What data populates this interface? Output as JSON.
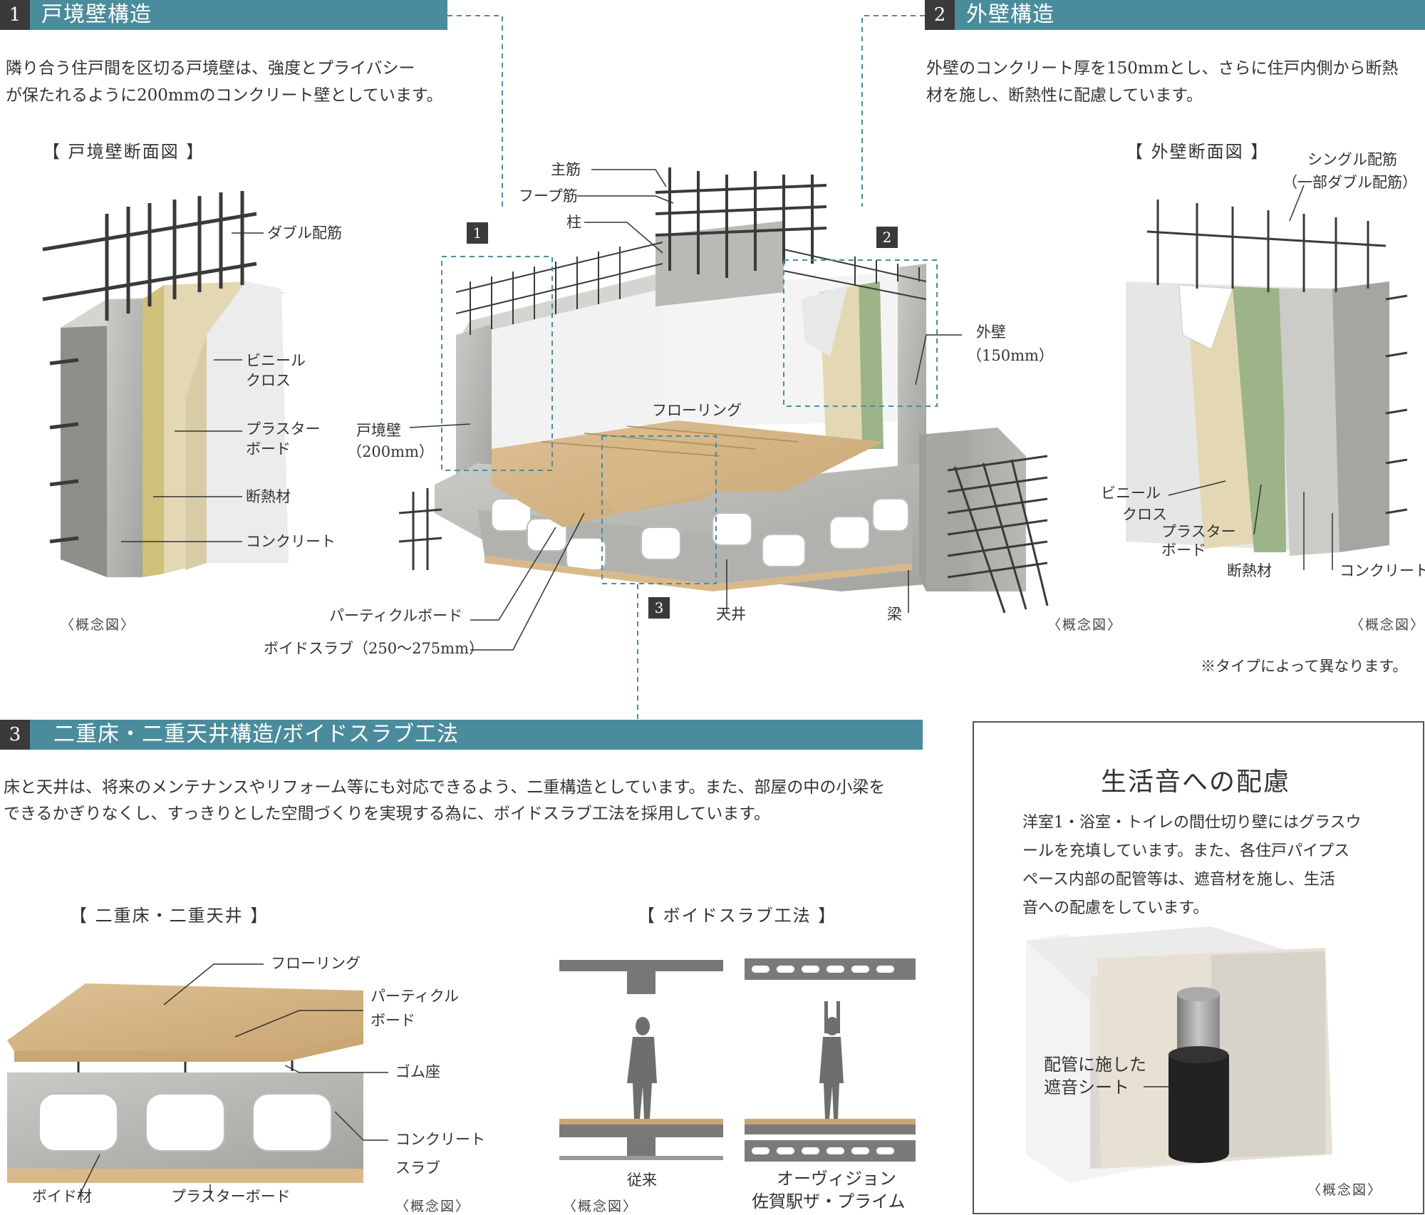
{
  "sections": {
    "s1": {
      "num": "1",
      "title": "戸境壁構造",
      "body": [
        "隣り合う住戸間を区切る戸境壁は、強度とプライバシー",
        "が保たれるように200mmのコンクリート壁としています。"
      ],
      "figure_title": "【 戸境壁断面図 】",
      "labels": {
        "double": "ダブル配筋",
        "vinyl_1": "ビニール",
        "vinyl_2": "クロス",
        "plaster_1": "プラスター",
        "plaster_2": "ボード",
        "insulation": "断熱材",
        "concrete": "コンクリート"
      },
      "concept": "〈概念図〉"
    },
    "s2": {
      "num": "2",
      "title": "外壁構造",
      "body": [
        "外壁のコンクリート厚を150mmとし、さらに住戸内側から断熱",
        "材を施し、断熱性に配慮しています。"
      ],
      "figure_title": "【 外壁断面図 】",
      "labels": {
        "single_1": "シングル配筋",
        "single_2": "（一部ダブル配筋）",
        "vinyl_1": "ビニール",
        "vinyl_2": "クロス",
        "plaster_1": "プラスター",
        "plaster_2": "ボード",
        "insulation": "断熱材",
        "concrete": "コンクリート"
      },
      "concept": "〈概念図〉",
      "note": "※タイプによって異なります。"
    },
    "s3": {
      "num": "3",
      "title": "二重床・二重天井構造/ボイドスラブ工法",
      "body": [
        "床と天井は、将来のメンテナンスやリフォーム等にも対応できるよう、二重構造としています。また、部屋の中の小梁を",
        "できるかぎりなくし、すっきりとした空間づくりを実現する為に、ボイドスラブ工法を採用しています。"
      ],
      "fig_a_title": "【 二重床・二重天井 】",
      "fig_a_labels": {
        "flooring": "フローリング",
        "particle_1": "パーティクル",
        "particle_2": "ボード",
        "rubber": "ゴム座",
        "slab_1": "コンクリート",
        "slab_2": "スラブ",
        "void": "ボイド材",
        "plaster": "プラスターボード"
      },
      "fig_a_concept": "〈概念図〉",
      "fig_b_title": "【 ボイドスラブ工法 】",
      "fig_b_labels": {
        "conventional": "従来",
        "ours_1": "オーヴィジョン",
        "ours_2": "佐賀駅ザ・プライム"
      },
      "fig_b_concept": "〈概念図〉"
    }
  },
  "center": {
    "labels": {
      "main_rebar": "主筋",
      "hoop": "フープ筋",
      "column": "柱",
      "ext_wall_1": "外壁",
      "ext_wall_2": "（150mm）",
      "party_wall_1": "戸境壁",
      "party_wall_2": "（200mm）",
      "flooring": "フローリング",
      "particle": "パーティクルボード",
      "void_slab": "ボイドスラブ（250〜275mm）",
      "ceiling": "天井",
      "beam": "梁"
    },
    "markers": [
      "1",
      "2",
      "3"
    ],
    "concept": "〈概念図〉"
  },
  "sound": {
    "title": "生活音への配慮",
    "body": [
      "洋室1・浴室・トイレの間仕切り壁にはグラスウ",
      "ールを充填しています。また、各住戸パイプス",
      "ペース内部の配管等は、遮音材を施し、生活",
      "音への配慮をしています。"
    ],
    "label_1": "配管に施した",
    "label_2": "遮音シート",
    "concept": "〈概念図〉"
  },
  "colors": {
    "teal": "#4a8c9c",
    "dark": "#3a3a3a",
    "concrete": "#b9b9b6",
    "wood": "#d9b98a",
    "insulation_yellow": "#cfc07a",
    "insulation_green": "#9cb487",
    "plaster": "#e4d8b4"
  }
}
